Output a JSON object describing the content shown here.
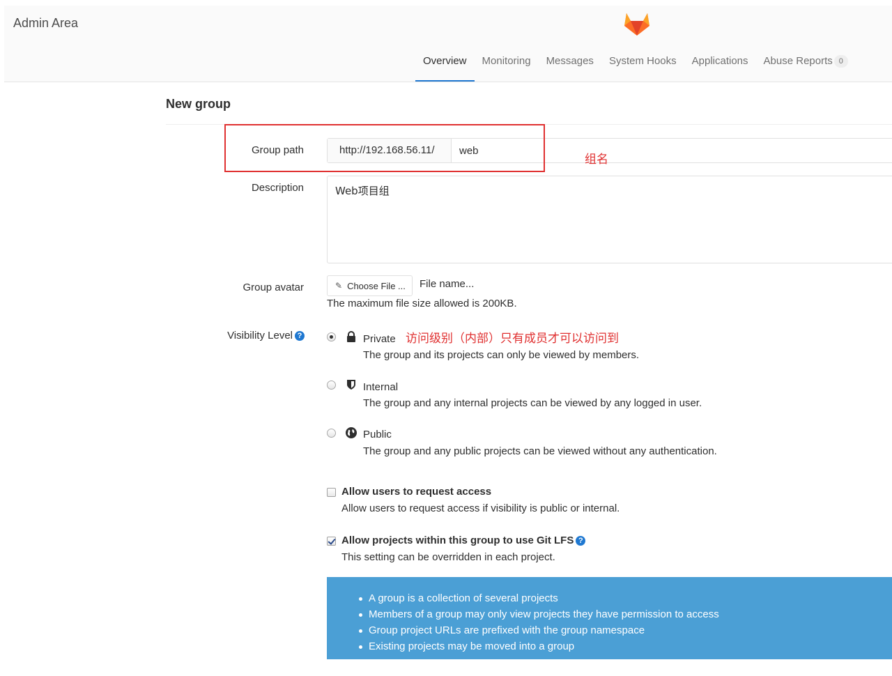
{
  "header": {
    "title": "Admin Area",
    "logo_icon": "gitlab-tanuki-icon",
    "nav": [
      {
        "label": "Overview",
        "active": true
      },
      {
        "label": "Monitoring",
        "active": false
      },
      {
        "label": "Messages",
        "active": false
      },
      {
        "label": "System Hooks",
        "active": false
      },
      {
        "label": "Applications",
        "active": false
      },
      {
        "label": "Abuse Reports",
        "active": false,
        "badge": "0"
      }
    ]
  },
  "page": {
    "title": "New group"
  },
  "form": {
    "group_path": {
      "label": "Group path",
      "prefix": "http://192.168.56.11/",
      "value": "web",
      "annotation": "组名"
    },
    "description": {
      "label": "Description",
      "value": "Web项目组"
    },
    "avatar": {
      "label": "Group avatar",
      "button_label": "Choose File ...",
      "file_name": "File name...",
      "help": "The maximum file size allowed is 200KB."
    },
    "visibility": {
      "label": "Visibility Level",
      "annotation": "访问级别（内部）只有成员才可以访问到",
      "options": [
        {
          "title": "Private",
          "description": "The group and its projects can only be viewed by members.",
          "icon": "lock-icon",
          "checked": true
        },
        {
          "title": "Internal",
          "description": "The group and any internal projects can be viewed by any logged in user.",
          "icon": "shield-icon",
          "checked": false
        },
        {
          "title": "Public",
          "description": "The group and any public projects can be viewed without any authentication.",
          "icon": "globe-icon",
          "checked": false
        }
      ]
    },
    "request_access": {
      "title": "Allow users to request access",
      "description": "Allow users to request access if visibility is public or internal.",
      "checked": false
    },
    "lfs": {
      "title": "Allow projects within this group to use Git LFS",
      "description": "This setting can be overridden in each project.",
      "checked": true
    }
  },
  "info": {
    "items": [
      "A group is a collection of several projects",
      "Members of a group may only view projects they have permission to access",
      "Group project URLs are prefixed with the group namespace",
      "Existing projects may be moved into a group"
    ]
  },
  "colors": {
    "accent": "#1f78d1",
    "annotation_red": "#e03030",
    "info_bg": "#4b9fd5"
  }
}
